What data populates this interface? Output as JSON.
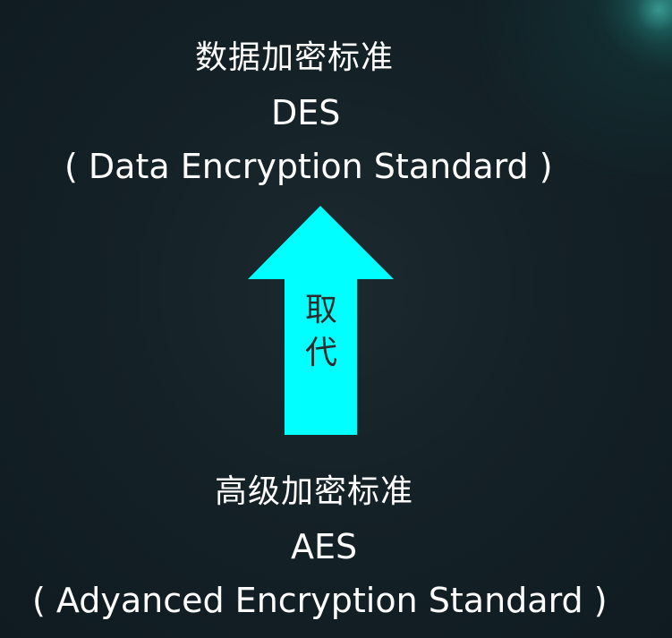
{
  "top_standard": {
    "chinese_name": "数据加密标准",
    "abbreviation": "DES",
    "full_name": "( Data Encryption Standard )"
  },
  "arrow": {
    "label_line1": "取",
    "label_line2": "代",
    "color": "#00FFFF"
  },
  "bottom_standard": {
    "chinese_name": "高级加密标准",
    "abbreviation": "AES",
    "full_name": "( Adyanced  Encryption  Standard )"
  }
}
